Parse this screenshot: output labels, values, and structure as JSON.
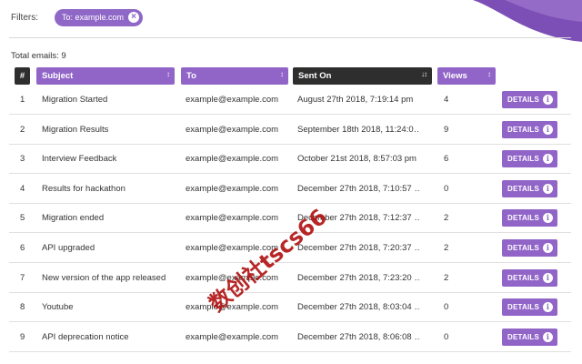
{
  "colors": {
    "accent": "#9165c8",
    "header_dark": "#2e2e2e",
    "deco": "#7c4fb6"
  },
  "filters": {
    "label": "Filters:",
    "chip": {
      "label": "To: example.com",
      "close_icon": "close-icon"
    }
  },
  "total": "Total emails: 9",
  "table": {
    "headers": {
      "num": "#",
      "subject": "Subject",
      "to": "To",
      "sent_on": "Sent On",
      "views": "Views"
    },
    "sort_icons": {
      "inactive": "↕",
      "active": "↓↕"
    },
    "details_label": "DETAILS",
    "details_icon": "info-icon",
    "rows": [
      {
        "num": "1",
        "subject": "Migration Started",
        "to": "example@example.com",
        "sent_on": "August 27th 2018, 7:19:14 pm",
        "views": "4"
      },
      {
        "num": "2",
        "subject": "Migration Results",
        "to": "example@example.com",
        "sent_on": "September 18th 2018, 11:24:0…",
        "views": "9"
      },
      {
        "num": "3",
        "subject": "Interview Feedback",
        "to": "example@example.com",
        "sent_on": "October 21st 2018, 8:57:03 pm",
        "views": "6"
      },
      {
        "num": "4",
        "subject": "Results for hackathon",
        "to": "example@example.com",
        "sent_on": "December 27th 2018, 7:10:57 …",
        "views": "0"
      },
      {
        "num": "5",
        "subject": "Migration ended",
        "to": "example@example.com",
        "sent_on": "December 27th 2018, 7:12:37 …",
        "views": "2"
      },
      {
        "num": "6",
        "subject": "API upgraded",
        "to": "example@example.com",
        "sent_on": "December 27th 2018, 7:20:37 …",
        "views": "2"
      },
      {
        "num": "7",
        "subject": "New version of the app released",
        "to": "example@example.com",
        "sent_on": "December 27th 2018, 7:23:20 …",
        "views": "2"
      },
      {
        "num": "8",
        "subject": "Youtube",
        "to": "example@example.com",
        "sent_on": "December 27th 2018, 8:03:04 …",
        "views": "0"
      },
      {
        "num": "9",
        "subject": "API deprecation notice",
        "to": "example@example.com",
        "sent_on": "December 27th 2018, 8:06:08 …",
        "views": "0"
      }
    ]
  },
  "watermark": "数创社tscs66"
}
